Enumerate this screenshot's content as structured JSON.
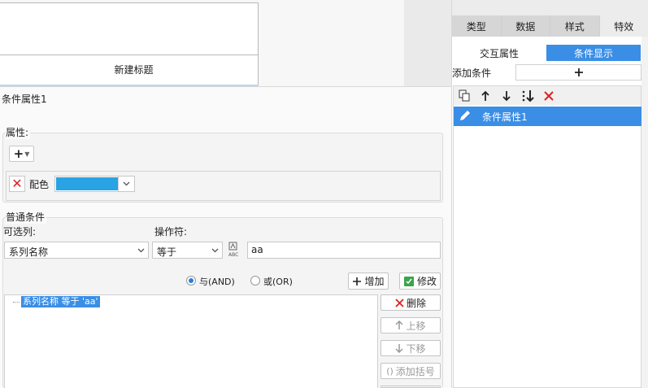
{
  "preview": {
    "cell_text": "新建标题"
  },
  "dialog": {
    "title": "条件属性1",
    "properties": {
      "label": "属性:",
      "add_icon": "plus-icon",
      "color_row": {
        "remove_icon": "close-icon",
        "label": "配色",
        "color": "#29a3e3"
      }
    },
    "condition": {
      "group_label": "普通条件",
      "column_label": "可选列:",
      "operator_label": "操作符:",
      "column_value": "系列名称",
      "operator_value": "等于",
      "value_type_icon": "abc-formula-icon",
      "value": "aa",
      "and_label": "与(AND)",
      "or_label": "或(OR)",
      "and_selected": true,
      "add_label": "增加",
      "modify_label": "修改",
      "items": [
        "系列名称 等于 'aa'"
      ],
      "delete_label": "删除",
      "up_label": "上移",
      "down_label": "下移",
      "bracket_label": "添加括号"
    }
  },
  "right_panel": {
    "tabs": [
      "类型",
      "数据",
      "样式",
      "特效"
    ],
    "active_tab": "特效",
    "subtabs": [
      "交互属性",
      "条件显示"
    ],
    "active_subtab": "条件显示",
    "add_condition_label": "添加条件",
    "add_condition_icon": "plus-icon",
    "toolbar_icons": [
      "copy-icon",
      "arrow-up-icon",
      "arrow-down-icon",
      "move-bottom-icon",
      "delete-icon"
    ],
    "list_items": [
      "条件属性1"
    ],
    "accent": "#3a8ee6"
  }
}
